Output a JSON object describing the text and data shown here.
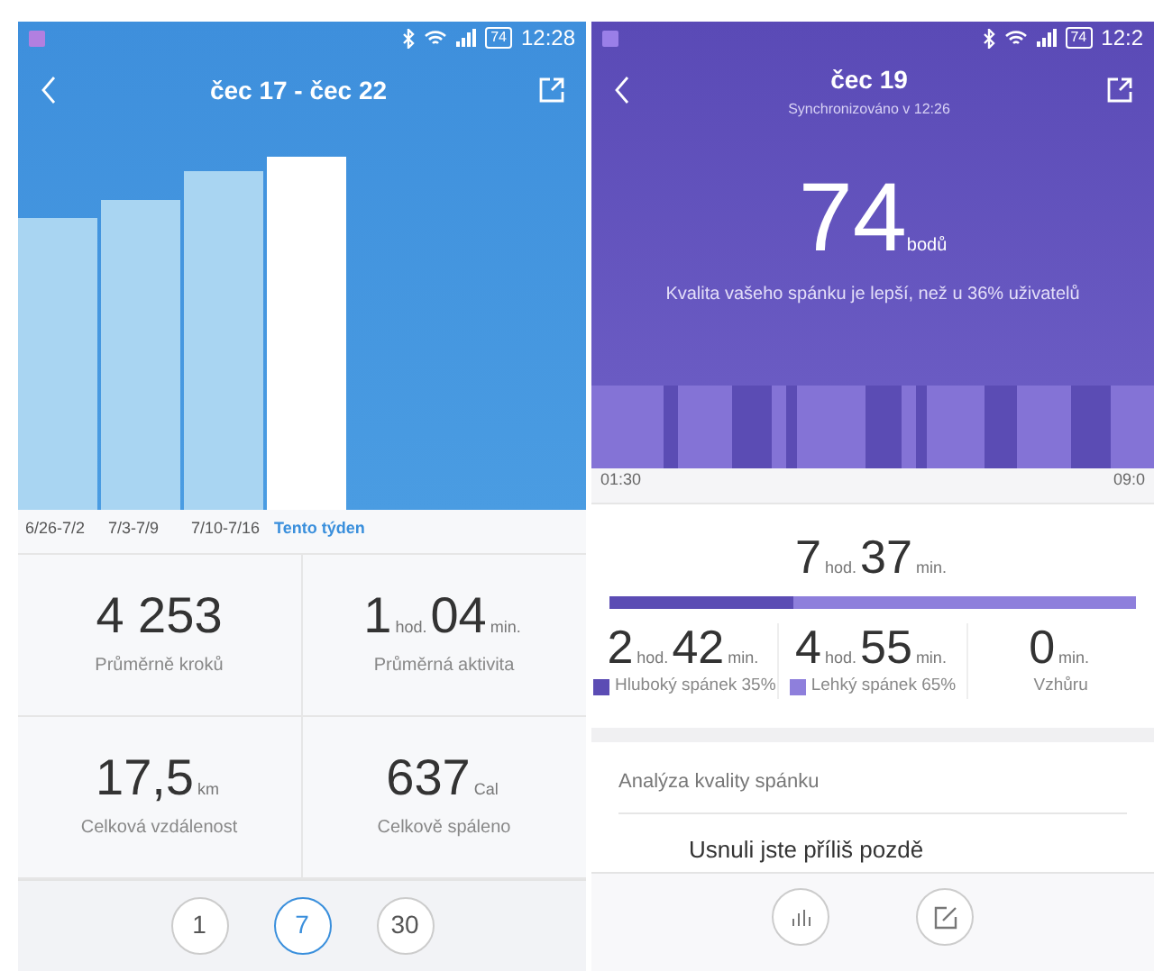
{
  "activity_screen": {
    "status_bar": {
      "battery": "74",
      "time": "12:28"
    },
    "title": "čec 17 - čec 22",
    "weeks": [
      {
        "label": "6/26-7/2",
        "selected": false
      },
      {
        "label": "7/3-7/9",
        "selected": false
      },
      {
        "label": "7/10-7/16",
        "selected": false
      },
      {
        "label": "Tento týden",
        "selected": true
      }
    ],
    "stats": [
      {
        "parts": [
          {
            "num": "4 253"
          }
        ],
        "label": "Průměrně kroků"
      },
      {
        "parts": [
          {
            "num": "1",
            "unit": "hod."
          },
          {
            "num": "04",
            "unit": "min."
          }
        ],
        "label": "Průměrná aktivita"
      },
      {
        "parts": [
          {
            "num": "17,5",
            "unit": "km"
          }
        ],
        "label": "Celková vzdálenost"
      },
      {
        "parts": [
          {
            "num": "637",
            "unit": "Cal"
          }
        ],
        "label": "Celkově spáleno"
      }
    ],
    "periods": [
      {
        "label": "1",
        "selected": false
      },
      {
        "label": "7",
        "selected": true
      },
      {
        "label": "30",
        "selected": false
      }
    ]
  },
  "sleep_screen": {
    "status_bar": {
      "battery": "74",
      "time": "12:2"
    },
    "title": "čec 19",
    "subtitle": "Synchronizováno v 12:26",
    "score": "74",
    "score_unit": "bodů",
    "comparison": "Kvalita vašeho spánku je lepší, než u 36% uživatelů",
    "start_time": "01:30",
    "end_time": "09:0",
    "total": [
      {
        "num": "7",
        "unit": "hod."
      },
      {
        "num": "37",
        "unit": "min."
      }
    ],
    "deep_share": {
      "level": 0.35
    },
    "stages": [
      {
        "parts": [
          {
            "num": "2",
            "unit": "hod."
          },
          {
            "num": "42",
            "unit": "min."
          }
        ],
        "label": "Hluboký spánek 35%",
        "color": "#5b4cb4"
      },
      {
        "parts": [
          {
            "num": "4",
            "unit": "hod."
          },
          {
            "num": "55",
            "unit": "min."
          }
        ],
        "label": "Lehký spánek 65%",
        "color": "#8e7fdc"
      },
      {
        "parts": [
          {
            "num": "0",
            "unit": "min."
          }
        ],
        "label": "Vzhůru"
      }
    ],
    "analysis_title": "Analýza kvality spánku",
    "analysis_item": "Usnuli jste příliš pozdě"
  }
}
